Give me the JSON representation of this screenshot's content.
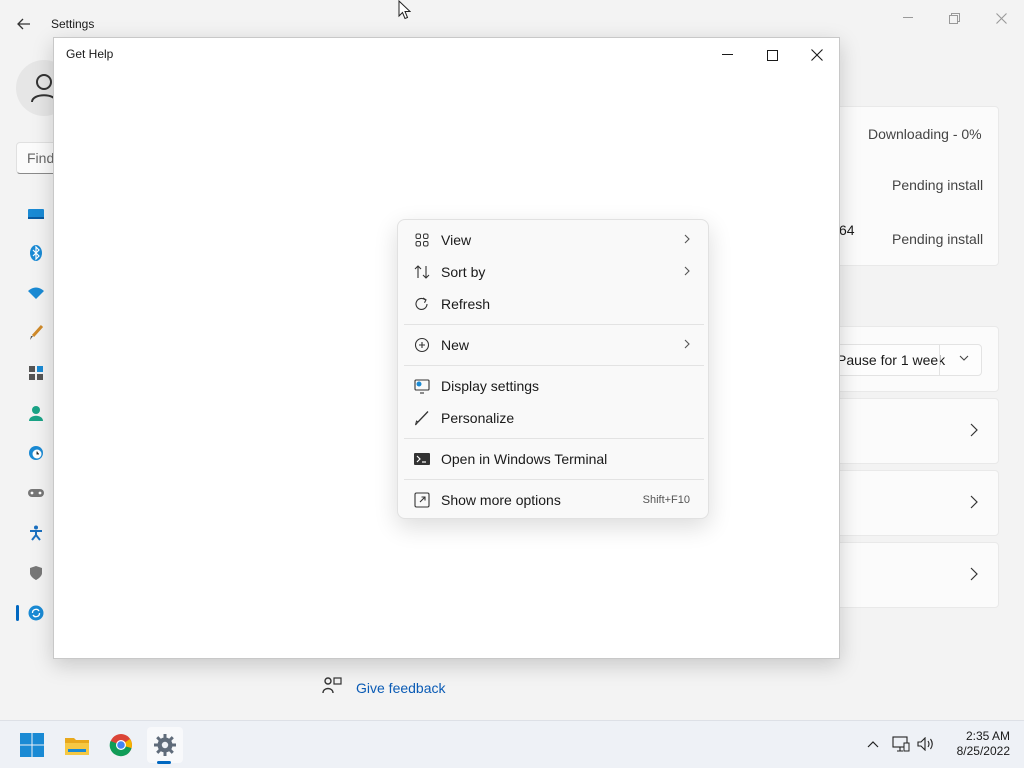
{
  "settings": {
    "title": "Settings",
    "search_placeholder": "Find",
    "updates": [
      {
        "status": "Downloading - 0%"
      },
      {
        "status": "Pending install"
      },
      {
        "fragment": "64",
        "status": "Pending install"
      }
    ],
    "pause_label": "Pause for 1 week",
    "feedback_label": "Give feedback"
  },
  "get_help": {
    "title": "Get Help"
  },
  "context_menu": {
    "items": [
      {
        "label": "View",
        "icon": "grid-view-icon",
        "submenu": true
      },
      {
        "label": "Sort by",
        "icon": "sort-icon",
        "submenu": true
      },
      {
        "label": "Refresh",
        "icon": "refresh-icon",
        "submenu": false
      },
      {
        "label": "New",
        "icon": "plus-circle-icon",
        "submenu": true
      },
      {
        "label": "Display settings",
        "icon": "display-settings-icon",
        "submenu": false
      },
      {
        "label": "Personalize",
        "icon": "brush-icon",
        "submenu": false
      },
      {
        "label": "Open in Windows Terminal",
        "icon": "terminal-icon",
        "submenu": false
      },
      {
        "label": "Show more options",
        "icon": "share-icon",
        "shortcut": "Shift+F10"
      }
    ]
  },
  "taskbar": {
    "apps": [
      "start-icon",
      "file-explorer-icon",
      "chrome-icon",
      "settings-icon"
    ],
    "time": "2:35 AM",
    "date": "8/25/2022"
  },
  "colors": {
    "accent": "#0067c0",
    "link": "#0a5bb5"
  }
}
